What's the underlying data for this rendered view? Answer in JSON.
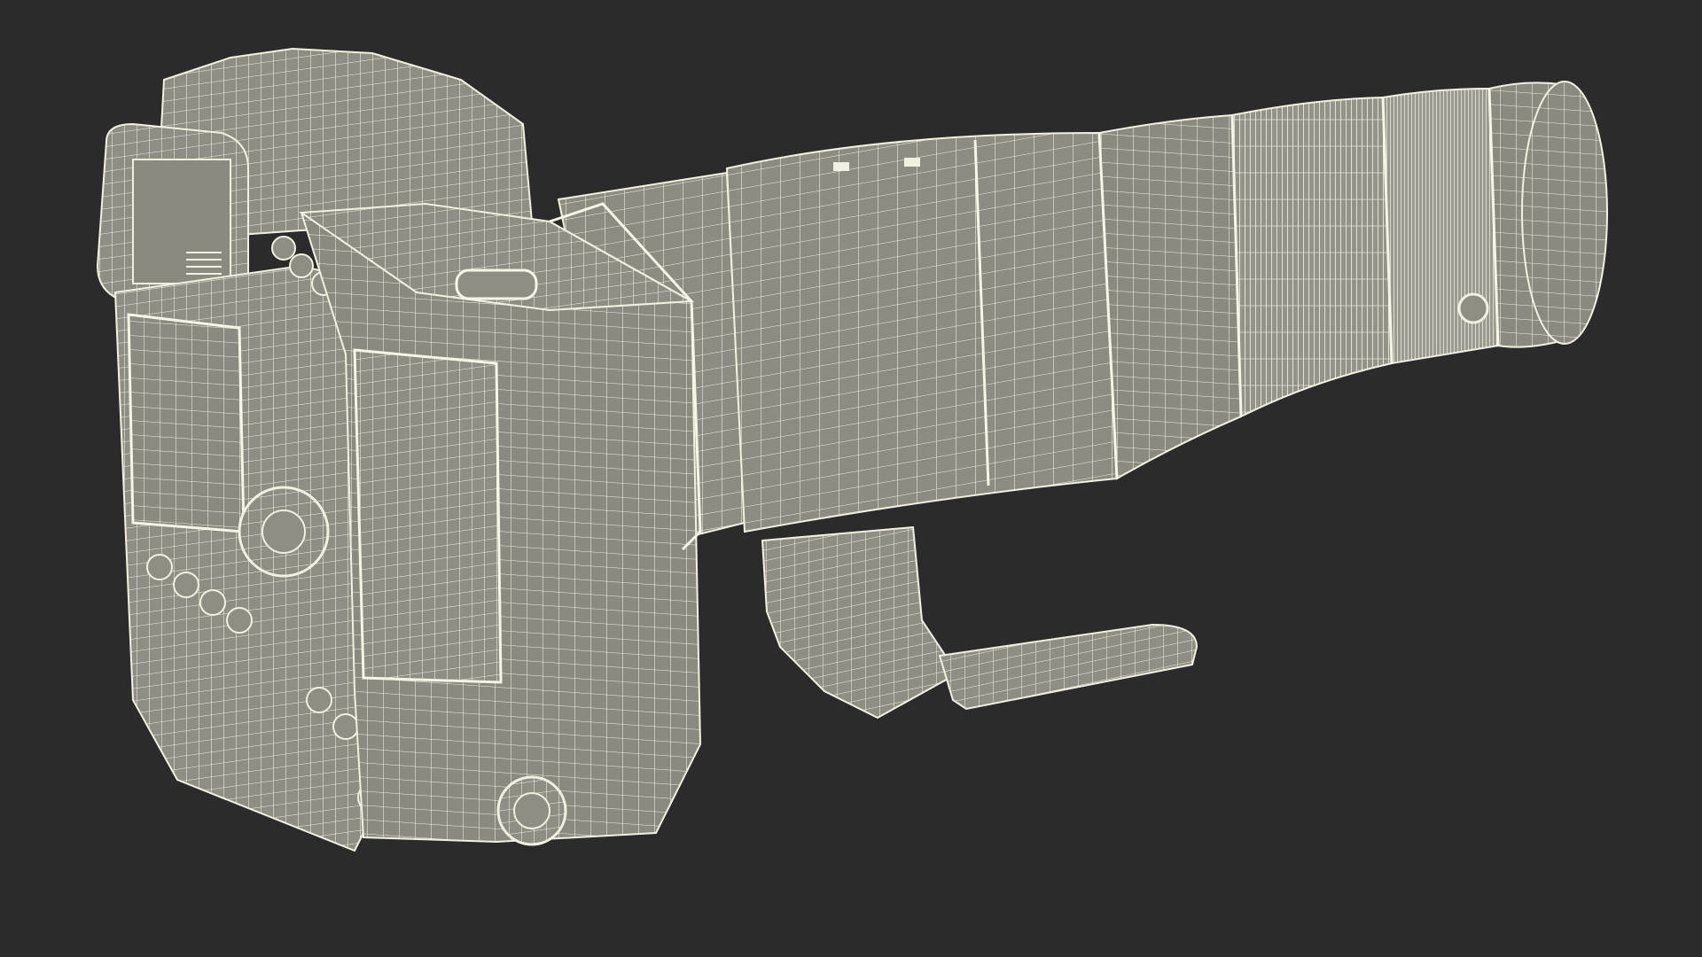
{
  "scene": {
    "background_color": "#2b2b2b",
    "model_fill_color": "#8e8e84",
    "model_shadow_color": "#6a6a62",
    "wire_color": "#f2f0e0",
    "subject": "camera-with-telephoto-lens-wireframe"
  }
}
